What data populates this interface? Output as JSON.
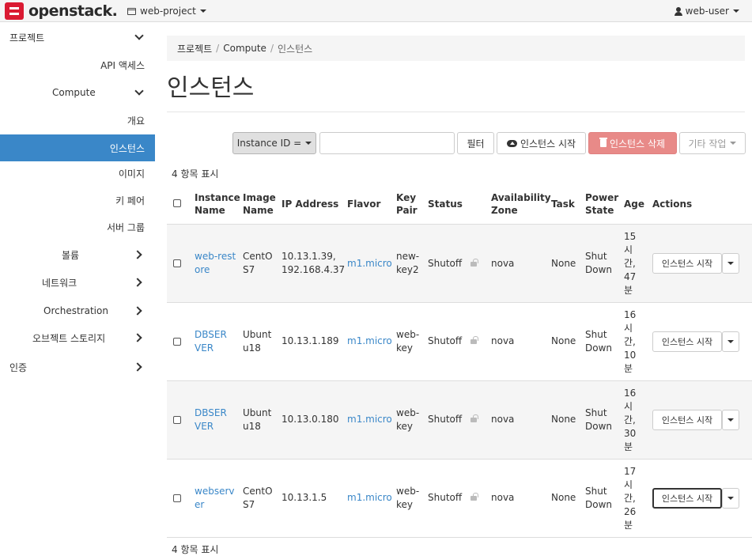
{
  "header": {
    "logo_text": "openstack.",
    "project": "web-project",
    "user": "web-user"
  },
  "sidebar": {
    "items": [
      {
        "label": "프로젝트",
        "chevron": "down"
      },
      {
        "label": "API 액세스"
      },
      {
        "label": "Compute",
        "chevron": "down"
      },
      {
        "label": "개요"
      },
      {
        "label": "인스턴스",
        "active": true
      },
      {
        "label": "이미지"
      },
      {
        "label": "키 페어"
      },
      {
        "label": "서버 그룹"
      },
      {
        "label": "볼륨",
        "chevron": "right"
      },
      {
        "label": "네트워크",
        "chevron": "right"
      },
      {
        "label": "Orchestration",
        "chevron": "right"
      },
      {
        "label": "오브젝트 스토리지",
        "chevron": "right"
      },
      {
        "label": "인증",
        "chevron": "right"
      }
    ]
  },
  "breadcrumb": [
    "프로젝트",
    "Compute",
    "인스턴스"
  ],
  "page_title": "인스턴스",
  "toolbar": {
    "filter_field": "Instance ID =",
    "filter_value": "",
    "filter_button": "필터",
    "launch_button": "인스턴스 시작",
    "delete_button": "인스턴스 삭제",
    "more_button": "기타 작업"
  },
  "count_text": "4 항목 표시",
  "table": {
    "headers": {
      "name": [
        "Instance",
        "Name"
      ],
      "image": [
        "Image",
        "Name"
      ],
      "ip": [
        "IP Address"
      ],
      "flavor": [
        "Flavor"
      ],
      "keypair": [
        "Key",
        "Pair"
      ],
      "status": [
        "Status"
      ],
      "az": [
        "Availability",
        "Zone"
      ],
      "task": [
        "Task"
      ],
      "power": [
        "Power",
        "State"
      ],
      "age": [
        "Age"
      ],
      "actions": [
        "Actions"
      ]
    },
    "rows": [
      {
        "name": [
          "web-rest",
          "ore"
        ],
        "image": [
          "CentO",
          "S7"
        ],
        "ip": [
          "10.13.1.39,",
          "192.168.4.37"
        ],
        "flavor": "m1.micro",
        "keypair": [
          "new-",
          "key2"
        ],
        "status": "Shutoff",
        "az": "nova",
        "task": "None",
        "power": [
          "Shut",
          "Down"
        ],
        "age": [
          "15",
          "시",
          "간,",
          "47",
          "분"
        ],
        "action": "인스턴스 시작"
      },
      {
        "name": [
          "DBSER",
          "VER"
        ],
        "image": [
          "Ubunt",
          "u18"
        ],
        "ip": [
          "10.13.1.189"
        ],
        "flavor": "m1.micro",
        "keypair": [
          "web-",
          "key"
        ],
        "status": "Shutoff",
        "az": "nova",
        "task": "None",
        "power": [
          "Shut",
          "Down"
        ],
        "age": [
          "16",
          "시",
          "간,",
          "10",
          "분"
        ],
        "action": "인스턴스 시작"
      },
      {
        "name": [
          "DBSER",
          "VER"
        ],
        "image": [
          "Ubunt",
          "u18"
        ],
        "ip": [
          "10.13.0.180"
        ],
        "flavor": "m1.micro",
        "keypair": [
          "web-",
          "key"
        ],
        "status": "Shutoff",
        "az": "nova",
        "task": "None",
        "power": [
          "Shut",
          "Down"
        ],
        "age": [
          "16",
          "시",
          "간,",
          "30",
          "분"
        ],
        "action": "인스턴스 시작"
      },
      {
        "name": [
          "webserv",
          "er"
        ],
        "image": [
          "CentO",
          "S7"
        ],
        "ip": [
          "10.13.1.5"
        ],
        "flavor": "m1.micro",
        "keypair": [
          "web-",
          "key"
        ],
        "status": "Shutoff",
        "az": "nova",
        "task": "None",
        "power": [
          "Shut",
          "Down"
        ],
        "age": [
          "17",
          "시",
          "간,",
          "26",
          "분"
        ],
        "action": "인스턴스 시작"
      }
    ]
  }
}
